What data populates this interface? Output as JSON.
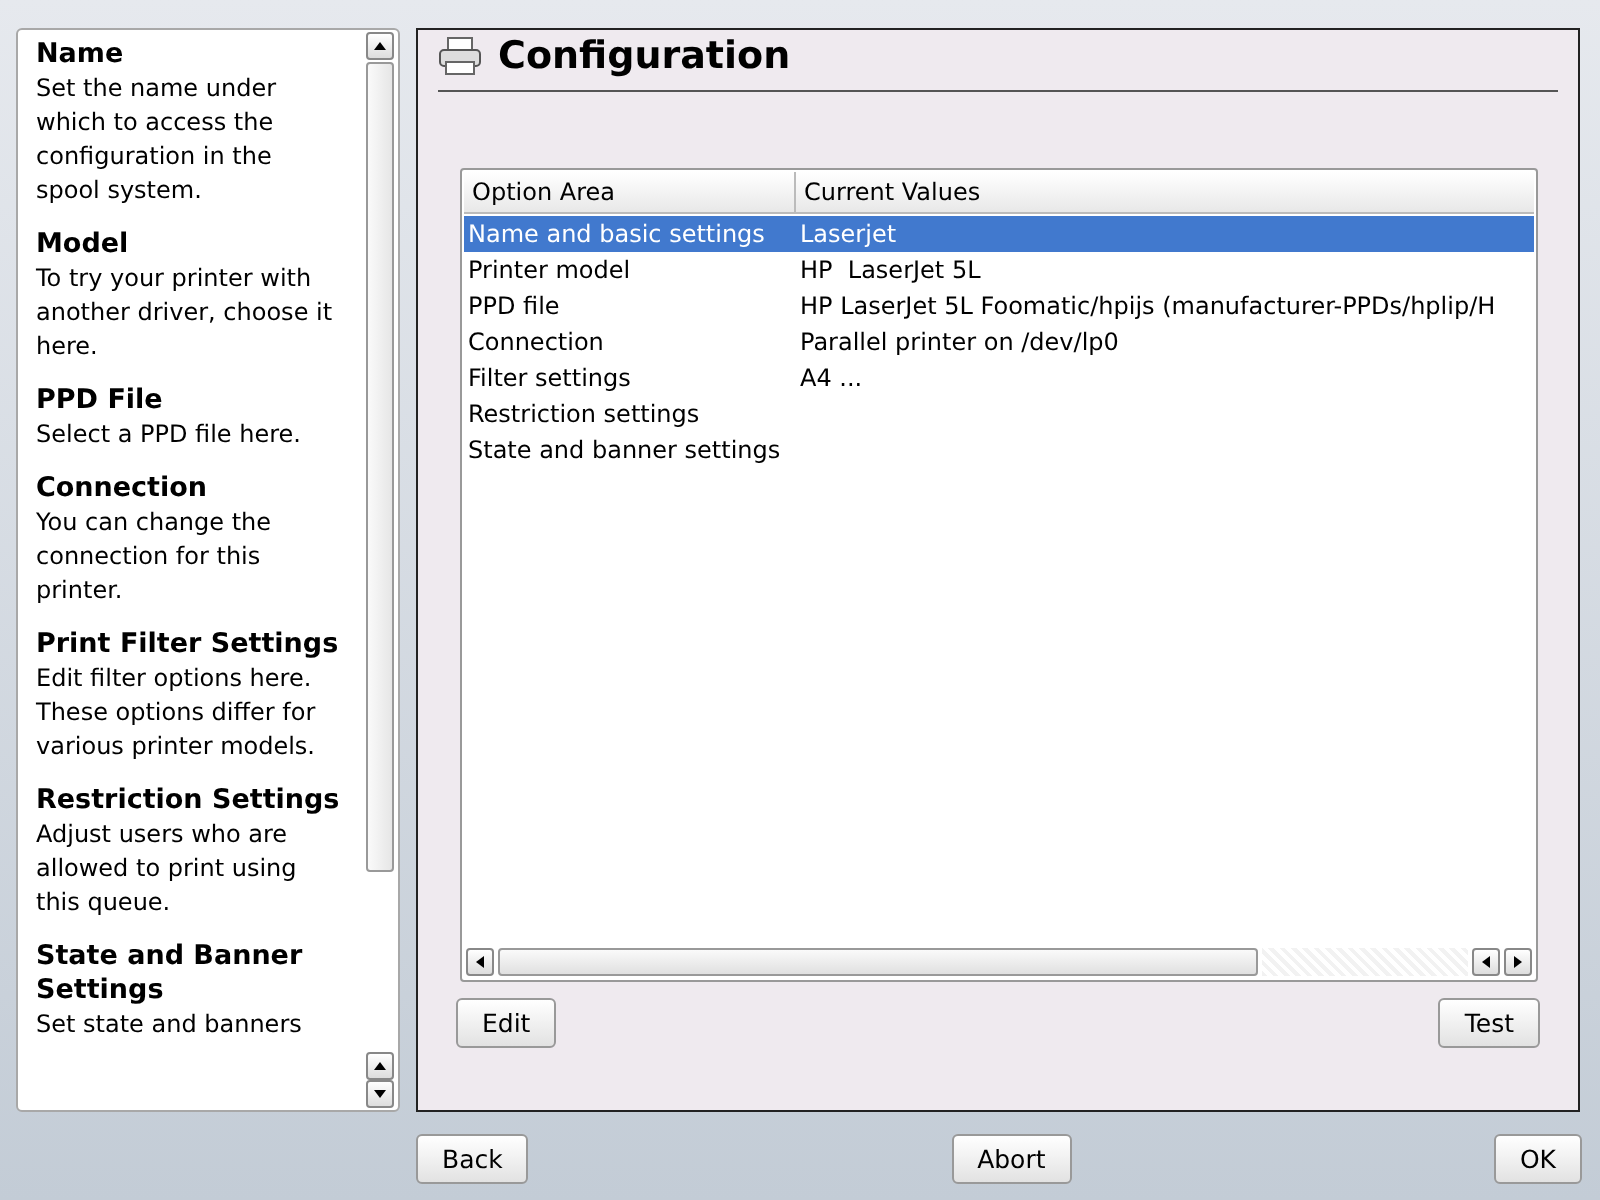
{
  "help": [
    {
      "title": "Name",
      "text": "Set the name under which to access the configuration in the spool system."
    },
    {
      "title": "Model",
      "text": "To try your printer with another driver, choose it here."
    },
    {
      "title": "PPD File",
      "text": "Select a PPD file here."
    },
    {
      "title": "Connection",
      "text": "You can change the connection for this printer."
    },
    {
      "title": "Print Filter Settings",
      "text": "Edit filter options here. These options differ for various printer models."
    },
    {
      "title": "Restriction Settings",
      "text": "Adjust users who are allowed to print using this queue."
    },
    {
      "title": "State and Banner Settings",
      "text": "Set state and banners"
    }
  ],
  "page": {
    "title": "Configuration"
  },
  "table": {
    "columns": [
      "Option Area",
      "Current Values"
    ],
    "rows": [
      {
        "area": "Name and basic settings",
        "value": "Laserjet",
        "selected": true
      },
      {
        "area": "Printer model",
        "value": "HP  LaserJet 5L",
        "selected": false
      },
      {
        "area": "PPD file",
        "value": "HP LaserJet 5L Foomatic/hpijs (manufacturer-PPDs/hplip/H",
        "selected": false
      },
      {
        "area": "Connection",
        "value": "Parallel printer on /dev/lp0",
        "selected": false
      },
      {
        "area": "Filter settings",
        "value": "A4 ...",
        "selected": false
      },
      {
        "area": "Restriction settings",
        "value": "",
        "selected": false
      },
      {
        "area": "State and banner settings",
        "value": "",
        "selected": false
      }
    ]
  },
  "table_buttons": [
    "Edit",
    "Test"
  ],
  "buttons": [
    "Back",
    "Abort",
    "OK"
  ]
}
